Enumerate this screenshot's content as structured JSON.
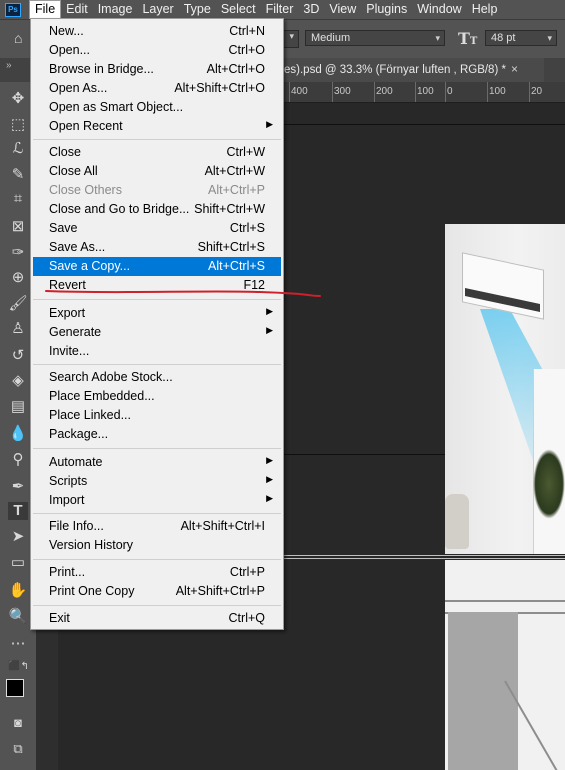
{
  "app": {
    "logo": "Ps"
  },
  "menubar": [
    "File",
    "Edit",
    "Image",
    "Layer",
    "Type",
    "Select",
    "Filter",
    "3D",
    "View",
    "Plugins",
    "Window",
    "Help"
  ],
  "options": {
    "font_weight": "Medium",
    "font_size": "48 pt"
  },
  "document_tab": {
    "title": "es).psd @ 33.3% (Förnyar luften , RGB/8) *"
  },
  "ruler": [
    "400",
    "300",
    "200",
    "100",
    "0",
    "100",
    "20"
  ],
  "file_menu": {
    "items": [
      {
        "label": "New...",
        "shortcut": "Ctrl+N"
      },
      {
        "label": "Open...",
        "shortcut": "Ctrl+O"
      },
      {
        "label": "Browse in Bridge...",
        "shortcut": "Alt+Ctrl+O"
      },
      {
        "label": "Open As...",
        "shortcut": "Alt+Shift+Ctrl+O"
      },
      {
        "label": "Open as Smart Object...",
        "shortcut": ""
      },
      {
        "label": "Open Recent",
        "shortcut": ""
      },
      {
        "label": "Close",
        "shortcut": "Ctrl+W"
      },
      {
        "label": "Close All",
        "shortcut": "Alt+Ctrl+W"
      },
      {
        "label": "Close Others",
        "shortcut": "Alt+Ctrl+P"
      },
      {
        "label": "Close and Go to Bridge...",
        "shortcut": "Shift+Ctrl+W"
      },
      {
        "label": "Save",
        "shortcut": "Ctrl+S"
      },
      {
        "label": "Save As...",
        "shortcut": "Shift+Ctrl+S"
      },
      {
        "label": "Save a Copy...",
        "shortcut": "Alt+Ctrl+S"
      },
      {
        "label": "Revert",
        "shortcut": "F12"
      },
      {
        "label": "Export",
        "shortcut": ""
      },
      {
        "label": "Generate",
        "shortcut": ""
      },
      {
        "label": "Invite...",
        "shortcut": ""
      },
      {
        "label": "Search Adobe Stock...",
        "shortcut": ""
      },
      {
        "label": "Place Embedded...",
        "shortcut": ""
      },
      {
        "label": "Place Linked...",
        "shortcut": ""
      },
      {
        "label": "Package...",
        "shortcut": ""
      },
      {
        "label": "Automate",
        "shortcut": ""
      },
      {
        "label": "Scripts",
        "shortcut": ""
      },
      {
        "label": "Import",
        "shortcut": ""
      },
      {
        "label": "File Info...",
        "shortcut": "Alt+Shift+Ctrl+I"
      },
      {
        "label": "Version History",
        "shortcut": ""
      },
      {
        "label": "Print...",
        "shortcut": "Ctrl+P"
      },
      {
        "label": "Print One Copy",
        "shortcut": "Alt+Shift+Ctrl+P"
      },
      {
        "label": "Exit",
        "shortcut": "Ctrl+Q"
      }
    ],
    "highlighted": "Save a Copy...",
    "disabled": [
      "Close Others"
    ],
    "submenus": [
      "Open Recent",
      "Export",
      "Generate",
      "Automate",
      "Scripts",
      "Import"
    ]
  },
  "colors": {
    "highlight": "#0078d7",
    "annotation": "#d0202a"
  },
  "tool_icons": [
    "move-tool-icon",
    "marquee-tool-icon",
    "lasso-tool-icon",
    "magic-wand-icon",
    "crop-tool-icon",
    "frame-tool-icon",
    "eyedropper-icon",
    "healing-brush-icon",
    "brush-icon",
    "stamp-icon",
    "history-brush-icon",
    "eraser-icon",
    "gradient-icon",
    "blur-icon",
    "dodge-icon",
    "pen-icon",
    "type-tool-icon",
    "path-select-icon",
    "rectangle-icon",
    "hand-icon",
    "zoom-icon",
    "more-tools-icon"
  ]
}
